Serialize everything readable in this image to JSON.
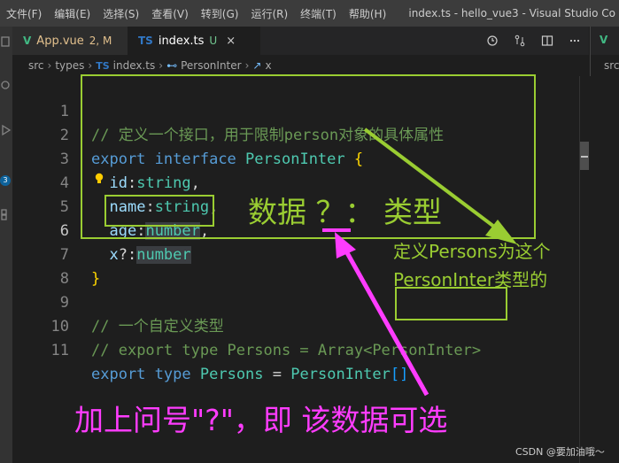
{
  "menu": [
    "文件(F)",
    "编辑(E)",
    "选择(S)",
    "查看(V)",
    "转到(G)",
    "运行(R)",
    "终端(T)",
    "帮助(H)"
  ],
  "window_title": "index.ts - hello_vue3 - Visual Studio Co",
  "tabs": [
    {
      "label": "App.vue",
      "badge": "2, M"
    },
    {
      "label": "index.ts",
      "badge": "U",
      "close": "×"
    }
  ],
  "activity_badge": "3",
  "right_pane_text": "src",
  "breadcrumb": {
    "parts": [
      "src",
      "types"
    ],
    "file": "index.ts",
    "interface": "PersonInter",
    "member": "x"
  },
  "code": {
    "l1": "// 定义一个接口，用于限制person对象的具体属性",
    "l2_kw": "export",
    "l2_kw2": "interface",
    "l2_ty": "PersonInter",
    "l2_br": "{",
    "l3_pr": "id",
    "l3_ty": "string",
    "l4_pr": "name",
    "l4_ty": "string",
    "l5_pr": "age",
    "l5_ty": "number",
    "l6_pr": "x",
    "l6_ty": "number",
    "l7_br": "}",
    "l9": "// 一个自定义类型",
    "l10_a": "// ",
    "l10_b": "export type Persons",
    "l10_c": " = Array<",
    "l10_d": "PersonInter",
    "l10_e": ">",
    "l11_kw": "export",
    "l11_kw2": "type",
    "l11_ty": "Persons",
    "l11_ty2": "PersonInter",
    "l11_br": "[]"
  },
  "annotations": {
    "data_type": "数据 ？： 类型",
    "persons_line1": "定义Persons为这个",
    "persons_line2": "PersonInter类型的",
    "optional": "加上问号\"?\"，即 该数据可选"
  },
  "footer": "CSDN @要加油哦～",
  "colors": {
    "annotation_green": "#9acd32",
    "annotation_pink": "#ff3cff"
  }
}
